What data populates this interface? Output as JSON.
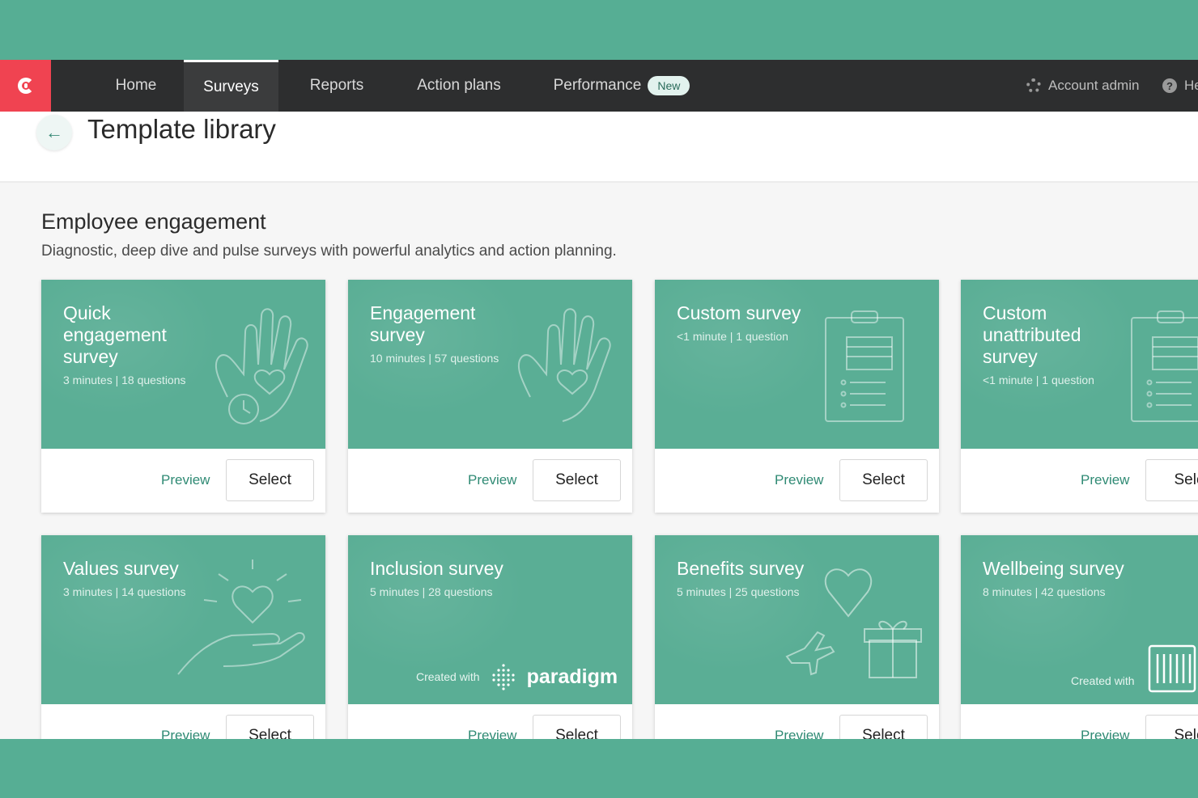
{
  "nav": {
    "items": [
      {
        "label": "Home"
      },
      {
        "label": "Surveys"
      },
      {
        "label": "Reports"
      },
      {
        "label": "Action plans"
      },
      {
        "label": "Performance",
        "badge": "New"
      }
    ],
    "account_admin": "Account admin",
    "help": "He"
  },
  "header": {
    "back_icon": "←",
    "title": "Template library"
  },
  "section": {
    "title": "Employee engagement",
    "description": "Diagnostic, deep dive and pulse surveys with powerful analytics and action planning."
  },
  "cards": [
    {
      "title": "Quick engagement survey",
      "meta": "3 minutes | 18 questions",
      "preview": "Preview",
      "select": "Select",
      "icon": "hand-heart-clock-icon"
    },
    {
      "title": "Engagement survey",
      "meta": "10 minutes | 57 questions",
      "preview": "Preview",
      "select": "Select",
      "icon": "hand-heart-icon"
    },
    {
      "title": "Custom survey",
      "meta": "<1 minute | 1 question",
      "preview": "Preview",
      "select": "Select",
      "icon": "clipboard-icon"
    },
    {
      "title": "Custom unattributed survey",
      "meta": "<1 minute | 1 question",
      "preview": "Preview",
      "select": "Sele",
      "icon": "clipboard-icon"
    },
    {
      "title": "Values survey",
      "meta": "3 minutes | 14 questions",
      "preview": "Preview",
      "select": "Select",
      "icon": "heart-in-hand-icon"
    },
    {
      "title": "Inclusion survey",
      "meta": "5 minutes | 28 questions",
      "preview": "Preview",
      "select": "Select",
      "created_with": "Created with",
      "partner": "paradigm"
    },
    {
      "title": "Benefits survey",
      "meta": "5 minutes | 25 questions",
      "preview": "Preview",
      "select": "Select",
      "icon": "heart-plane-gift-icon"
    },
    {
      "title": "Wellbeing survey",
      "meta": "8 minutes | 42 questions",
      "preview": "Preview",
      "select": "Sele",
      "created_with": "Created with"
    }
  ],
  "colors": {
    "brand_red": "#f04351",
    "nav_bg": "#2d2e2f",
    "card_green": "#5aae95",
    "frame_green": "#56ae94",
    "link_green": "#2f8a74"
  }
}
